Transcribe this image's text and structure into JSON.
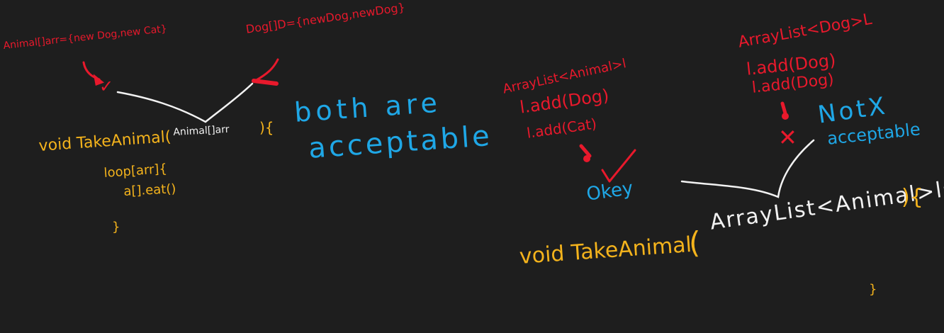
{
  "colors": {
    "background": "#1e1e1e",
    "red": "#e8192c",
    "yellow": "#f4b31c",
    "white": "#f2f2f2",
    "blue": "#1fa7e6"
  },
  "left": {
    "red_note_1": "Animal[]arr={new Dog,new Cat}",
    "red_note_2": "Dog[]D={newDog,newDog}",
    "check_mark": "✓",
    "method_sig_yellow": "void TakeAnimal(",
    "method_sig_white": "Animal[]arr",
    "method_sig_close": "){",
    "body_line_1": "loop[arr]{",
    "body_line_2": "a[].eat()",
    "closing_brace": "}",
    "both_line_1": "both are",
    "both_line_2": "acceptable"
  },
  "right": {
    "animal_list_title": "ArrayList<Animal>l",
    "animal_list_line_1": "l.add(Dog)",
    "animal_list_line_2": "l.add(Cat)",
    "ok_text": "Okey",
    "dog_list_title": "ArrayList<Dog>L",
    "dog_list_line_1": "l.add(Dog)",
    "dog_list_line_2": "l.add(Dog)",
    "x_mark": "✕",
    "not_text": "NotX",
    "not_acceptable": "acceptable",
    "method_sig_yellow": "void TakeAnimal",
    "method_sig_paren": "(",
    "method_sig_white": "ArrayList<Animal>lsT",
    "method_sig_close": "){",
    "closing_brace": "}"
  }
}
